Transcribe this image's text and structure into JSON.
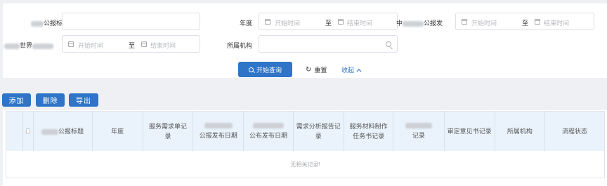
{
  "filters": {
    "row1": {
      "title_label": "公报标题",
      "year_label": "年度",
      "year_start": "开始时间",
      "range_to": "至",
      "year_end": "结束时间",
      "publish_label_prefix": "中",
      "publish_label": "公报发",
      "publish_start": "开始时间",
      "publish_end": "结束时间"
    },
    "row2": {
      "world_label": "世界",
      "world_start": "开始时间",
      "range_to": "至",
      "world_end": "结束时间",
      "org_label": "所属机构"
    }
  },
  "actions": {
    "search": "开始查询",
    "reset": "重置",
    "collapse": "收起",
    "collapse_icon": "chevron-up-icon"
  },
  "toolbar": {
    "add": "添加",
    "delete": "删除",
    "export": "导出"
  },
  "table": {
    "columns": [
      "公报标题",
      "年度",
      "服务需求单记录",
      "公报发布日期",
      "公布发布日期",
      "需求分析报告记录",
      "服务材料制作任务书记录",
      "记录",
      "审定意见书记录",
      "所属机构",
      "流程状态"
    ],
    "empty_text": "无相关记录!"
  },
  "colors": {
    "primary": "#2f74c6",
    "header_bg": "#eaf3fb",
    "page_bg": "#eef0f3"
  }
}
